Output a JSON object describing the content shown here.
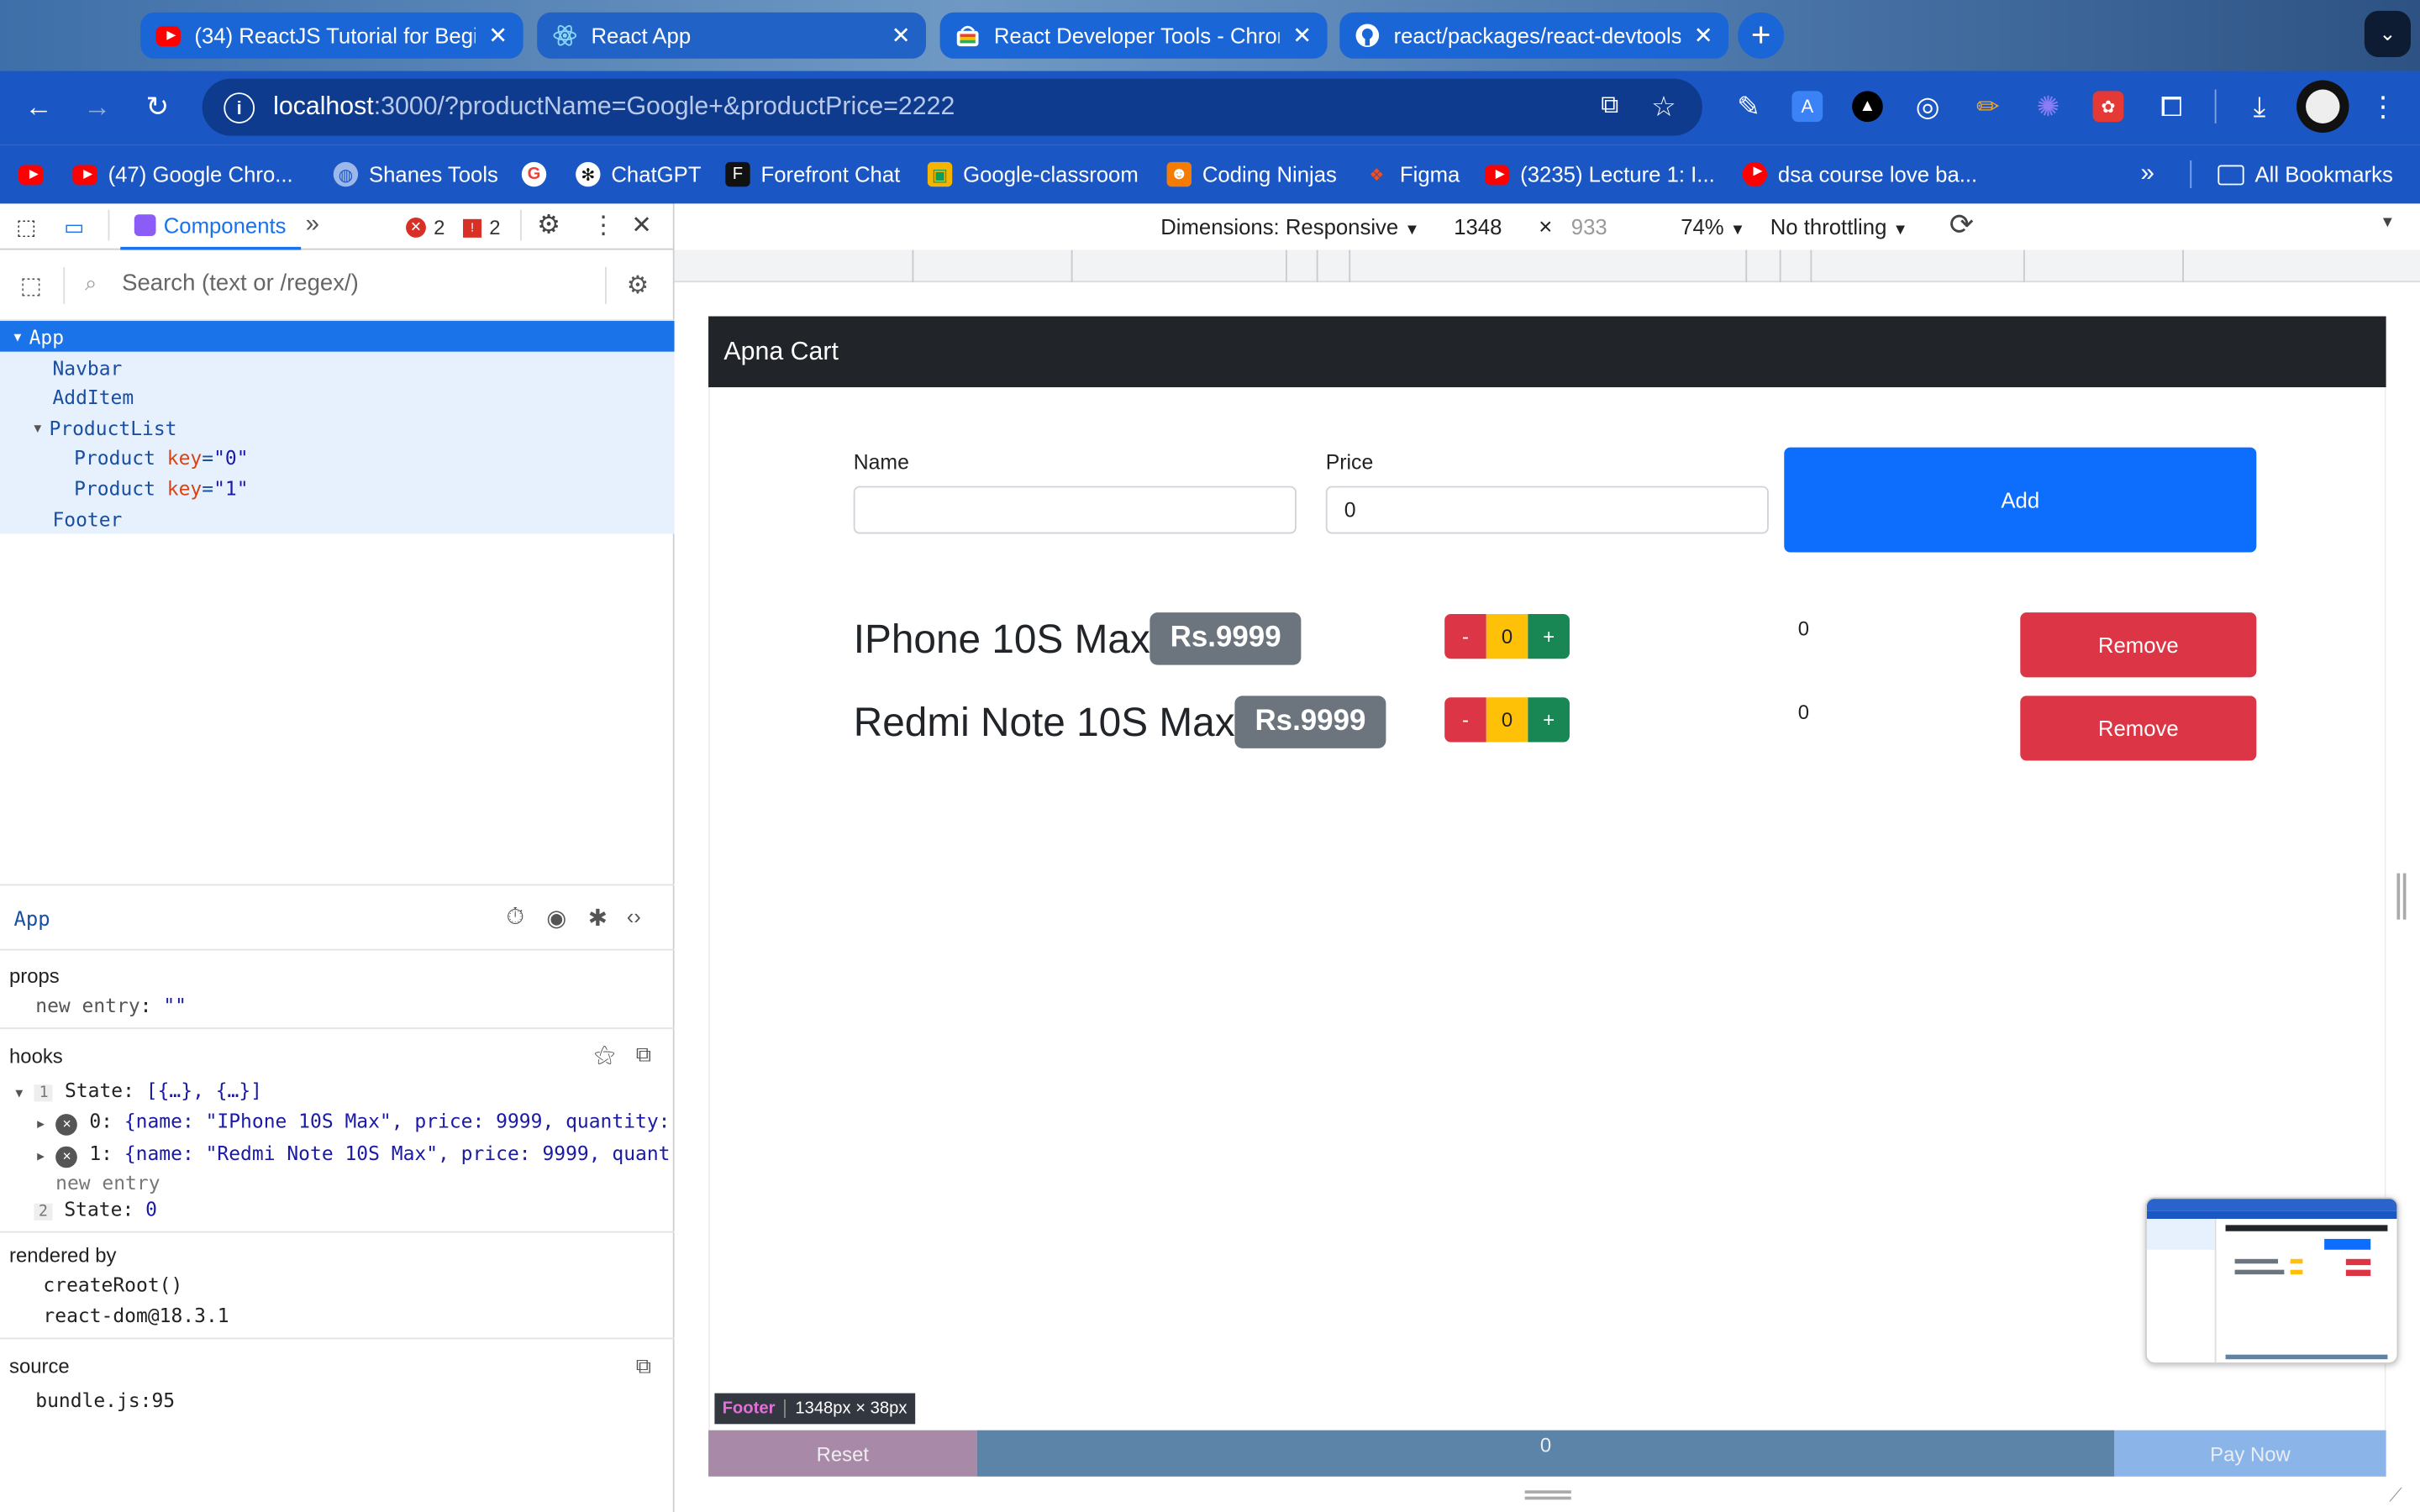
{
  "browser": {
    "tabs": [
      {
        "title": "(34) ReactJS Tutorial for Beginners",
        "icon": "youtube-icon"
      },
      {
        "title": "React App",
        "icon": "react-icon"
      },
      {
        "title": "React Developer Tools - Chrome",
        "icon": "chrome-web-store-icon"
      },
      {
        "title": "react/packages/react-devtools",
        "icon": "github-icon"
      }
    ],
    "url_host": "localhost",
    "url_rest": ":3000/?productName=Google+&productPrice=2222",
    "bookmarks": [
      {
        "label": "",
        "icon": "youtube-icon"
      },
      {
        "label": "(47) Google Chro...",
        "icon": "youtube-icon"
      },
      {
        "label": "Shanes Tools",
        "icon": "globe-icon"
      },
      {
        "label": "",
        "icon": "google-icon"
      },
      {
        "label": "ChatGPT",
        "icon": "chatgpt-icon"
      },
      {
        "label": "Forefront Chat",
        "icon": "forefront-icon"
      },
      {
        "label": "Google-classroom",
        "icon": "classroom-icon"
      },
      {
        "label": "Coding Ninjas",
        "icon": "coding-ninjas-icon"
      },
      {
        "label": "Figma",
        "icon": "figma-icon"
      },
      {
        "label": "(3235) Lecture 1: I...",
        "icon": "youtube-icon"
      },
      {
        "label": "dsa course love ba...",
        "icon": "youtube-icon"
      }
    ],
    "all_bookmarks": "All Bookmarks"
  },
  "devtools": {
    "tab_label": "Components",
    "errors": "2",
    "warnings": "2",
    "search_placeholder": "Search (text or /regex/)",
    "tree": [
      {
        "name": "App",
        "selected": true
      },
      {
        "name": "Navbar"
      },
      {
        "name": "AddItem"
      },
      {
        "name": "ProductList"
      },
      {
        "name": "Product",
        "key_label": "key",
        "key_value": "\"0\""
      },
      {
        "name": "Product",
        "key_label": "key",
        "key_value": "\"1\""
      },
      {
        "name": "Footer"
      }
    ],
    "inspected": "App",
    "props_title": "props",
    "props_entry_key": "new entry",
    "props_entry_value": "\"\"",
    "hooks_title": "hooks",
    "hook1_index": "1",
    "hook1_label": "State:",
    "hook1_value": "[{…}, {…}]",
    "hook1_item0_key": "0:",
    "hook1_item0_value": "{name: \"IPhone 10S Max\", price: 9999, quantity:…",
    "hook1_item1_key": "1:",
    "hook1_item1_value": "{name: \"Redmi Note 10S Max\", price: 9999, quant…",
    "hook1_new_entry": "new entry",
    "hook2_index": "2",
    "hook2_label": "State:",
    "hook2_value": "0",
    "rendered_by_title": "rendered by",
    "rendered_by": [
      "createRoot()",
      "react-dom@18.3.1"
    ],
    "source_title": "source",
    "source_value": "bundle.js:95"
  },
  "device_toolbar": {
    "dimensions": "Dimensions: Responsive",
    "width": "1348",
    "times": "×",
    "height": "933",
    "zoom": "74%",
    "throttling": "No throttling"
  },
  "app": {
    "brand": "Apna Cart",
    "name_label": "Name",
    "name_value": "",
    "price_label": "Price",
    "price_value": "0",
    "add_label": "Add",
    "products": [
      {
        "name": "IPhone 10S Max",
        "price": "Rs.9999",
        "minus": "-",
        "quantity": "0",
        "plus": "+",
        "total": "0",
        "remove": "Remove"
      },
      {
        "name": "Redmi Note 10S Max",
        "price": "Rs.9999",
        "minus": "-",
        "quantity": "0",
        "plus": "+",
        "total": "0",
        "remove": "Remove"
      }
    ],
    "footer_reset": "Reset",
    "footer_total": "0",
    "footer_pay": "Pay Now",
    "tooltip_name": "Footer",
    "tooltip_size": "1348px × 38px"
  },
  "colors": {
    "tab_blue": "#1b66d6",
    "toolbar_blue": "#1b57c4",
    "navbar_dark": "#212529",
    "primary": "#0d6efd",
    "danger": "#dc3545",
    "warning": "#ffc107",
    "success": "#198754",
    "secondary": "#6c757d"
  }
}
